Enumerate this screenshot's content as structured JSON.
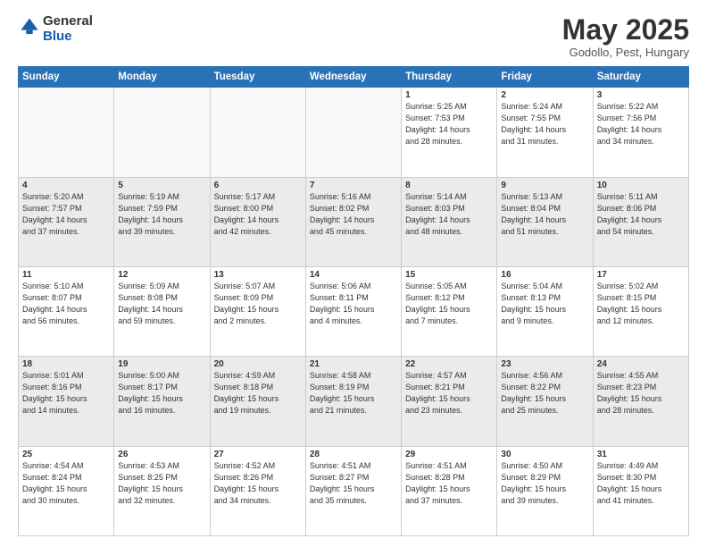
{
  "header": {
    "logo_general": "General",
    "logo_blue": "Blue",
    "title": "May 2025",
    "location": "Godollo, Pest, Hungary"
  },
  "days_of_week": [
    "Sunday",
    "Monday",
    "Tuesday",
    "Wednesday",
    "Thursday",
    "Friday",
    "Saturday"
  ],
  "weeks": [
    [
      {
        "day": "",
        "info": ""
      },
      {
        "day": "",
        "info": ""
      },
      {
        "day": "",
        "info": ""
      },
      {
        "day": "",
        "info": ""
      },
      {
        "day": "1",
        "info": "Sunrise: 5:25 AM\nSunset: 7:53 PM\nDaylight: 14 hours\nand 28 minutes."
      },
      {
        "day": "2",
        "info": "Sunrise: 5:24 AM\nSunset: 7:55 PM\nDaylight: 14 hours\nand 31 minutes."
      },
      {
        "day": "3",
        "info": "Sunrise: 5:22 AM\nSunset: 7:56 PM\nDaylight: 14 hours\nand 34 minutes."
      }
    ],
    [
      {
        "day": "4",
        "info": "Sunrise: 5:20 AM\nSunset: 7:57 PM\nDaylight: 14 hours\nand 37 minutes."
      },
      {
        "day": "5",
        "info": "Sunrise: 5:19 AM\nSunset: 7:59 PM\nDaylight: 14 hours\nand 39 minutes."
      },
      {
        "day": "6",
        "info": "Sunrise: 5:17 AM\nSunset: 8:00 PM\nDaylight: 14 hours\nand 42 minutes."
      },
      {
        "day": "7",
        "info": "Sunrise: 5:16 AM\nSunset: 8:02 PM\nDaylight: 14 hours\nand 45 minutes."
      },
      {
        "day": "8",
        "info": "Sunrise: 5:14 AM\nSunset: 8:03 PM\nDaylight: 14 hours\nand 48 minutes."
      },
      {
        "day": "9",
        "info": "Sunrise: 5:13 AM\nSunset: 8:04 PM\nDaylight: 14 hours\nand 51 minutes."
      },
      {
        "day": "10",
        "info": "Sunrise: 5:11 AM\nSunset: 8:06 PM\nDaylight: 14 hours\nand 54 minutes."
      }
    ],
    [
      {
        "day": "11",
        "info": "Sunrise: 5:10 AM\nSunset: 8:07 PM\nDaylight: 14 hours\nand 56 minutes."
      },
      {
        "day": "12",
        "info": "Sunrise: 5:09 AM\nSunset: 8:08 PM\nDaylight: 14 hours\nand 59 minutes."
      },
      {
        "day": "13",
        "info": "Sunrise: 5:07 AM\nSunset: 8:09 PM\nDaylight: 15 hours\nand 2 minutes."
      },
      {
        "day": "14",
        "info": "Sunrise: 5:06 AM\nSunset: 8:11 PM\nDaylight: 15 hours\nand 4 minutes."
      },
      {
        "day": "15",
        "info": "Sunrise: 5:05 AM\nSunset: 8:12 PM\nDaylight: 15 hours\nand 7 minutes."
      },
      {
        "day": "16",
        "info": "Sunrise: 5:04 AM\nSunset: 8:13 PM\nDaylight: 15 hours\nand 9 minutes."
      },
      {
        "day": "17",
        "info": "Sunrise: 5:02 AM\nSunset: 8:15 PM\nDaylight: 15 hours\nand 12 minutes."
      }
    ],
    [
      {
        "day": "18",
        "info": "Sunrise: 5:01 AM\nSunset: 8:16 PM\nDaylight: 15 hours\nand 14 minutes."
      },
      {
        "day": "19",
        "info": "Sunrise: 5:00 AM\nSunset: 8:17 PM\nDaylight: 15 hours\nand 16 minutes."
      },
      {
        "day": "20",
        "info": "Sunrise: 4:59 AM\nSunset: 8:18 PM\nDaylight: 15 hours\nand 19 minutes."
      },
      {
        "day": "21",
        "info": "Sunrise: 4:58 AM\nSunset: 8:19 PM\nDaylight: 15 hours\nand 21 minutes."
      },
      {
        "day": "22",
        "info": "Sunrise: 4:57 AM\nSunset: 8:21 PM\nDaylight: 15 hours\nand 23 minutes."
      },
      {
        "day": "23",
        "info": "Sunrise: 4:56 AM\nSunset: 8:22 PM\nDaylight: 15 hours\nand 25 minutes."
      },
      {
        "day": "24",
        "info": "Sunrise: 4:55 AM\nSunset: 8:23 PM\nDaylight: 15 hours\nand 28 minutes."
      }
    ],
    [
      {
        "day": "25",
        "info": "Sunrise: 4:54 AM\nSunset: 8:24 PM\nDaylight: 15 hours\nand 30 minutes."
      },
      {
        "day": "26",
        "info": "Sunrise: 4:53 AM\nSunset: 8:25 PM\nDaylight: 15 hours\nand 32 minutes."
      },
      {
        "day": "27",
        "info": "Sunrise: 4:52 AM\nSunset: 8:26 PM\nDaylight: 15 hours\nand 34 minutes."
      },
      {
        "day": "28",
        "info": "Sunrise: 4:51 AM\nSunset: 8:27 PM\nDaylight: 15 hours\nand 35 minutes."
      },
      {
        "day": "29",
        "info": "Sunrise: 4:51 AM\nSunset: 8:28 PM\nDaylight: 15 hours\nand 37 minutes."
      },
      {
        "day": "30",
        "info": "Sunrise: 4:50 AM\nSunset: 8:29 PM\nDaylight: 15 hours\nand 39 minutes."
      },
      {
        "day": "31",
        "info": "Sunrise: 4:49 AM\nSunset: 8:30 PM\nDaylight: 15 hours\nand 41 minutes."
      }
    ]
  ]
}
